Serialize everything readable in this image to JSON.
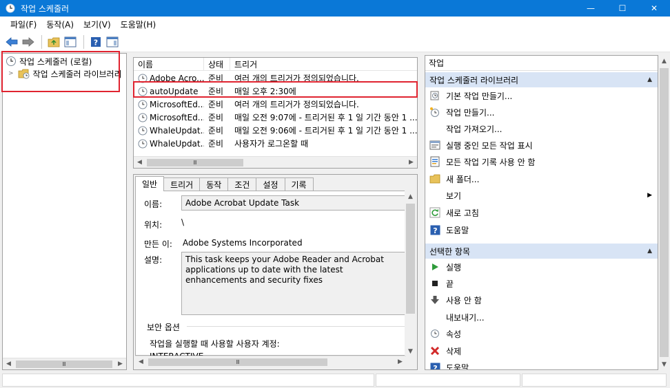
{
  "window": {
    "title": "작업 스케줄러",
    "minimize": "—",
    "maximize": "☐",
    "close": "✕"
  },
  "menu": {
    "items": [
      "파일(F)",
      "동작(A)",
      "보기(V)",
      "도움말(H)"
    ]
  },
  "tree": {
    "root_label": "작업 스케줄러 (로컬)",
    "library_label": "작업 스케줄러 라이브러리"
  },
  "tasklist": {
    "headers": [
      "이름",
      "상태",
      "트리거"
    ],
    "rows": [
      {
        "name": "Adobe Acro...",
        "status": "준비",
        "trigger": "여러 개의 트리거가 정의되었습니다."
      },
      {
        "name": "autoUpdate",
        "status": "준비",
        "trigger": "매일 오후 2:30에"
      },
      {
        "name": "MicrosoftEd...",
        "status": "준비",
        "trigger": "여러 개의 트리거가 정의되었습니다."
      },
      {
        "name": "MicrosoftEd...",
        "status": "준비",
        "trigger": "매일 오전 9:07에 - 트리거된 후 1 일 기간 동안 1 ..."
      },
      {
        "name": "WhaleUpdat...",
        "status": "준비",
        "trigger": "매일 오전 9:06에 - 트리거된 후 1 일 기간 동안 1 ..."
      },
      {
        "name": "WhaleUpdat...",
        "status": "준비",
        "trigger": "사용자가 로그온할 때"
      }
    ]
  },
  "detail": {
    "tabs": [
      "일반",
      "트리거",
      "동작",
      "조건",
      "설정",
      "기록"
    ],
    "name_label": "이름:",
    "name_value": "Adobe Acrobat Update Task",
    "location_label": "위치:",
    "location_value": "\\",
    "author_label": "만든 이:",
    "author_value": "Adobe Systems Incorporated",
    "desc_label": "설명:",
    "desc_value": "This task keeps your Adobe Reader and Acrobat applications up to date with the latest enhancements and security fixes",
    "security_group": "보안 옵션",
    "security_text": "작업을 실행할 때 사용할 사용자 계정:",
    "security_user": "INTERACTIVE"
  },
  "actions": {
    "header": "작업",
    "section1": "작업 스케줄러 라이브러리",
    "items1": [
      "기본 작업 만들기...",
      "작업 만들기...",
      "작업 가져오기...",
      "실행 중인 모든 작업 표시",
      "모든 작업 기록 사용 안 함",
      "새 폴더...",
      "보기",
      "새로 고침",
      "도움말"
    ],
    "section2": "선택한 항목",
    "items2": [
      "실행",
      "끝",
      "사용 안 함",
      "내보내기...",
      "속성",
      "삭제",
      "도움말"
    ]
  },
  "colors": {
    "titlebar": "#0a78d7",
    "highlight": "#e0232f",
    "section": "#d8e4f5"
  }
}
